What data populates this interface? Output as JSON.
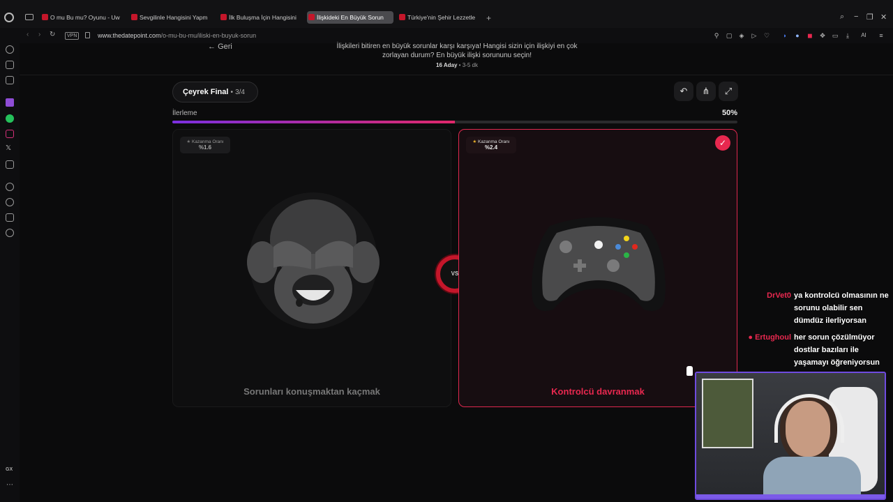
{
  "browser": {
    "tabs": [
      {
        "label": "O mu Bu mu? Oyunu - Uw"
      },
      {
        "label": "Sevgilinle Hangisini Yapm"
      },
      {
        "label": "İlk Buluşma İçin Hangisini"
      },
      {
        "label": "İlişkideki En Büyük Sorun"
      },
      {
        "label": "Türkiye'nin Şehir Lezzetle"
      }
    ],
    "url_domain": "www.thedatepoint.com",
    "url_path": "/o-mu-bu-mu/iliski-en-buyuk-sorun",
    "vpn_label": "VPN",
    "gx_label": "GX",
    "ai_label": "AI"
  },
  "page": {
    "back_label": "Geri",
    "subtitle": "İlişkileri bitiren en büyük sorunlar karşı karşıya! Hangisi sizin için ilişkiyi en çok zorlayan durum? En büyük ilişki sorununu seçin!",
    "meta_candidates": "16 Aday",
    "meta_separator": "•",
    "meta_duration": "3-5 dk",
    "round_name": "Çeyrek Final",
    "round_separator": "•",
    "round_count": "3/4",
    "progress_label": "İlerleme",
    "progress_percent_text": "50%",
    "progress_value": 0.5,
    "vs_label": "VS"
  },
  "cards": {
    "left": {
      "winrate_label": "Kazanma Oranı",
      "winrate_value": "%1.6",
      "title": "Sorunları konuşmaktan kaçmak",
      "icon": "see-no-evil-monkey-icon",
      "selected": false
    },
    "right": {
      "winrate_label": "Kazanma Oranı",
      "winrate_value": "%2.4",
      "title": "Kontrolcü davranmak",
      "icon": "game-controller-icon",
      "selected": true
    }
  },
  "chat": [
    {
      "user": "DrVet0",
      "user_color": "#e8284f",
      "text": "ya kontrolcü olmasının ne sorunu olabilir sen dümdüz ilerliyorsan"
    },
    {
      "user": "Ertughoul",
      "user_color": "#e8284f",
      "text": "her sorun çözülmüyor dostlar bazıları ile yaşamayı öğreniyorsun"
    }
  ],
  "colors": {
    "accent": "#e8284f",
    "progress_start": "#7b2fe0",
    "progress_end": "#e0286a",
    "webcam_border": "#6f4be0"
  }
}
